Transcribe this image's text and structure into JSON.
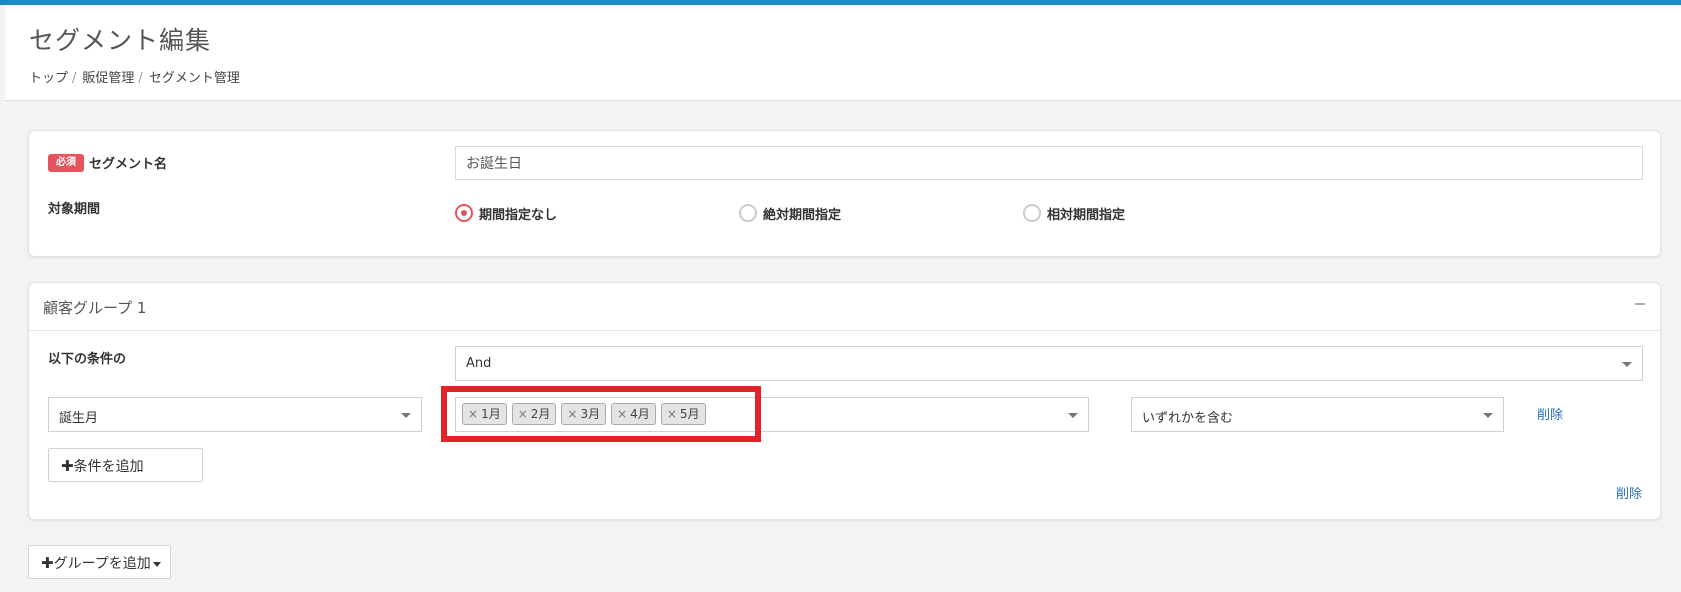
{
  "header": {
    "title": "セグメント編集",
    "breadcrumb": [
      "トップ",
      "販促管理",
      "セグメント管理"
    ],
    "separator": "/"
  },
  "segment_form": {
    "required_badge": "必須",
    "name_label": "セグメント名",
    "name_value": "お誕生日",
    "period_label": "対象期間",
    "period_options": [
      {
        "label": "期間指定なし",
        "selected": true
      },
      {
        "label": "絶対期間指定",
        "selected": false
      },
      {
        "label": "相対期間指定",
        "selected": false
      }
    ]
  },
  "group": {
    "title": "顧客グループ 1",
    "collapse_icon": "minus-icon",
    "condition_label": "以下の条件の",
    "logic_value": "And",
    "condition": {
      "field": "誕生月",
      "tags": [
        "1月",
        "2月",
        "3月",
        "4月",
        "5月"
      ],
      "tag_remove_glyph": "×",
      "operator": "いずれかを含む",
      "delete_label": "削除"
    },
    "add_condition_label": "条件を追加",
    "delete_group_label": "削除"
  },
  "add_group_label": "グループを追加",
  "colors": {
    "accent_bar": "#1a8ac4",
    "required": "#e5535d",
    "link": "#2a6ebb",
    "highlight": "#e3222a"
  }
}
